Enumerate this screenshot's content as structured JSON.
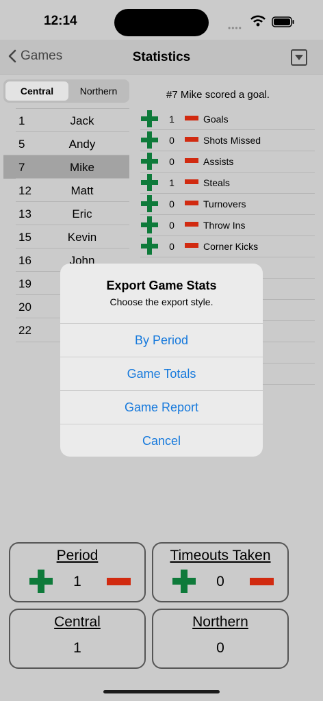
{
  "status_bar": {
    "time": "12:14",
    "signal_dots": "••••"
  },
  "nav": {
    "back_label": "Games",
    "title": "Statistics"
  },
  "teams": {
    "selected": "Central",
    "other": "Northern"
  },
  "roster": [
    {
      "number": "1",
      "name": "Jack"
    },
    {
      "number": "5",
      "name": "Andy"
    },
    {
      "number": "7",
      "name": "Mike",
      "selected": true
    },
    {
      "number": "12",
      "name": "Matt"
    },
    {
      "number": "13",
      "name": "Eric"
    },
    {
      "number": "15",
      "name": "Kevin"
    },
    {
      "number": "16",
      "name": "John"
    },
    {
      "number": "19",
      "name": ""
    },
    {
      "number": "20",
      "name": ""
    },
    {
      "number": "22",
      "name": ""
    }
  ],
  "event_message": "#7 Mike scored a goal.",
  "stats": [
    {
      "value": "1",
      "label": "Goals"
    },
    {
      "value": "0",
      "label": "Shots Missed"
    },
    {
      "value": "0",
      "label": "Assists"
    },
    {
      "value": "1",
      "label": "Steals"
    },
    {
      "value": "0",
      "label": "Turnovers"
    },
    {
      "value": "0",
      "label": "Throw Ins"
    },
    {
      "value": "0",
      "label": "Corner Kicks"
    }
  ],
  "panels": {
    "period": {
      "title": "Period",
      "value": "1"
    },
    "timeouts": {
      "title": "Timeouts Taken",
      "value": "0"
    },
    "central": {
      "title": "Central",
      "value": "1"
    },
    "northern": {
      "title": "Northern",
      "value": "0"
    }
  },
  "dialog": {
    "title": "Export Game Stats",
    "message": "Choose the export style.",
    "actions": [
      "By Period",
      "Game Totals",
      "Game Report",
      "Cancel"
    ]
  },
  "colors": {
    "accent_blue": "#1679dc",
    "plus_green": "#0e7a3a",
    "minus_red": "#d12a10"
  }
}
